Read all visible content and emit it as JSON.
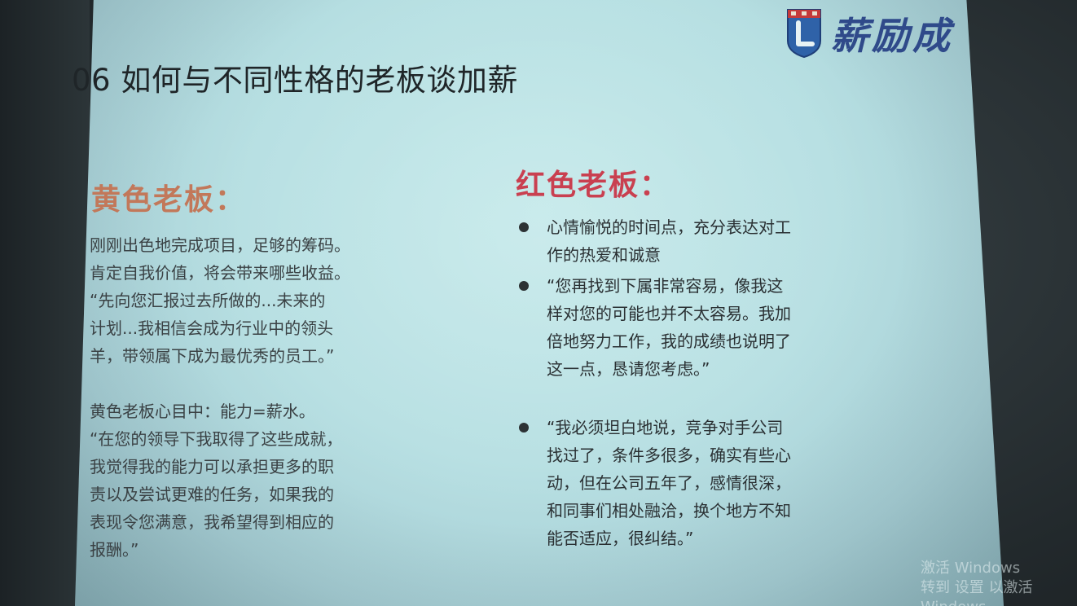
{
  "slide": {
    "title": "06 如何与不同性格的老板谈加薪",
    "logo_text": "薪励成",
    "yellow": {
      "heading": "黄色老板：",
      "paragraph1": [
        "刚刚出色地完成项目，足够的筹码。",
        "肯定自我价值，将会带来哪些收益。",
        "“先向您汇报过去所做的...未来的",
        "计划...我相信会成为行业中的领头",
        "羊，带领属下成为最优秀的员工。”"
      ],
      "paragraph2": [
        "黄色老板心目中：能力=薪水。",
        "“在您的领导下我取得了这些成就，",
        "我觉得我的能力可以承担更多的职",
        "责以及尝试更难的任务，如果我的",
        "表现令您满意，我希望得到相应的",
        "报酬。”"
      ]
    },
    "red": {
      "heading": "红色老板：",
      "bullets": [
        [
          "心情愉悦的时间点，充分表达对工",
          "作的热爱和诚意"
        ],
        [
          "“您再找到下属非常容易，像我这",
          "样对您的可能也并不太容易。我加",
          "倍地努力工作，我的成绩也说明了",
          "这一点，恳请您考虑。”"
        ],
        [
          "“我必须坦白地说，竞争对手公司",
          "找过了，条件多很多，确实有些心",
          "动，但在公司五年了，感情很深，",
          "和同事们相处融洽，换个地方不知",
          "能否适应，很纠结。”"
        ]
      ]
    }
  },
  "overlay": {
    "watermark_line1": "激活 Windows",
    "watermark_line2": "转到 设置 以激活 Windows"
  },
  "colors": {
    "yellow_heading": "#c2785a",
    "red_heading": "#c94050",
    "logo_blue": "#2f4a8a"
  }
}
